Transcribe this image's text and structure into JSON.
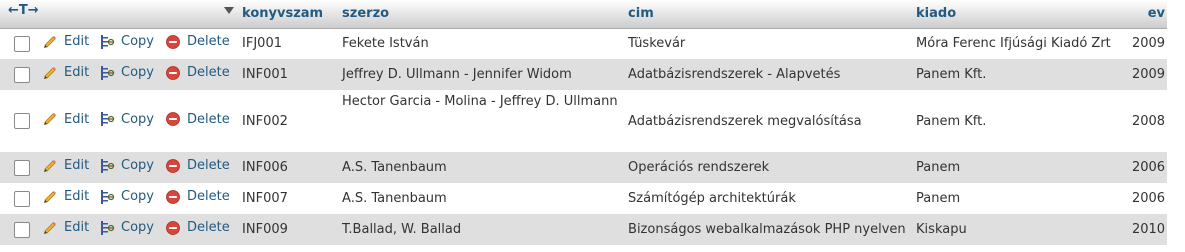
{
  "header": {
    "col1": "konyvszam",
    "col2": "szerzo",
    "col3": "cim",
    "col4": "kiado",
    "col5": "ev",
    "arrows": "←T→"
  },
  "actions": {
    "edit": "Edit",
    "copy": "Copy",
    "delete": "Delete"
  },
  "rows": [
    {
      "konyvszam": "IFJ001",
      "szerzo": "Fekete István",
      "cim": "Tüskevár",
      "kiado": "Móra Ferenc Ifjúsági Kiadó Zrt",
      "ev": "2009"
    },
    {
      "konyvszam": "INF001",
      "szerzo": "Jeffrey D. Ullmann - Jennifer Widom",
      "cim": "Adatbázisrendszerek - Alapvetés",
      "kiado": "Panem Kft.",
      "ev": "2009"
    },
    {
      "konyvszam": "INF002",
      "szerzo": "Hector Garcia - Molina - Jeffrey D. Ullmann",
      "cim": "Adatbázisrendszerek megvalósítása",
      "kiado": "Panem Kft.",
      "ev": "2008"
    },
    {
      "konyvszam": "INF006",
      "szerzo": "A.S. Tanenbaum",
      "cim": "Operációs rendszerek",
      "kiado": "Panem",
      "ev": "2006"
    },
    {
      "konyvszam": "INF007",
      "szerzo": "A.S. Tanenbaum",
      "cim": "Számítógép architektúrák",
      "kiado": "Panem",
      "ev": "2006"
    },
    {
      "konyvszam": "INF009",
      "szerzo": "T.Ballad, W. Ballad",
      "cim": "Bizonságos webalkalmazások PHP nyelven",
      "kiado": "Kiskapu",
      "ev": "2010"
    }
  ],
  "icons": {
    "edit": "pencil-icon",
    "copy": "copy-icon",
    "delete": "delete-icon"
  },
  "colors": {
    "link": "#235a81",
    "row_alt": "#dfdfdf",
    "delete_red": "#d9453a"
  }
}
